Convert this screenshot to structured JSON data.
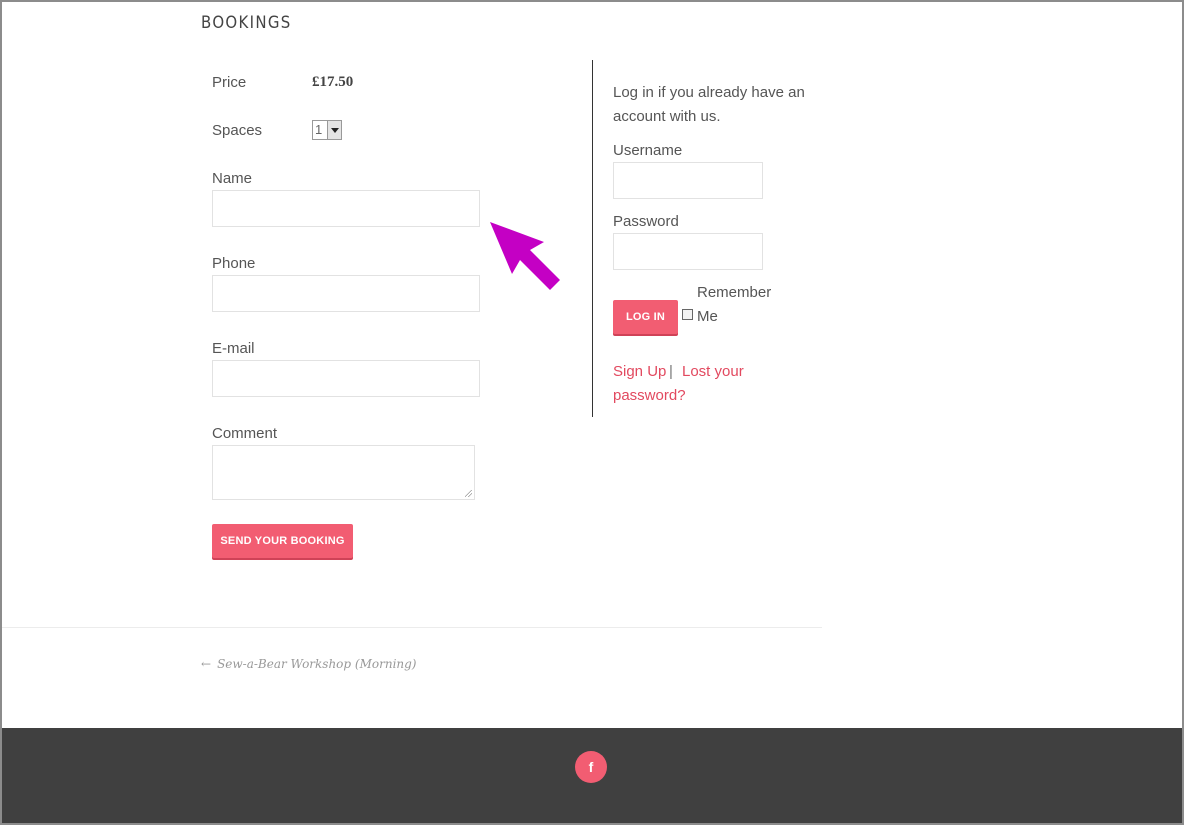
{
  "page": {
    "heading": "BOOKINGS"
  },
  "booking_form": {
    "price_label": "Price",
    "price_value": "£17.50",
    "spaces_label": "Spaces",
    "spaces_value": "1",
    "name_label": "Name",
    "phone_label": "Phone",
    "email_label": "E-mail",
    "comment_label": "Comment",
    "submit_label": "SEND YOUR BOOKING"
  },
  "login": {
    "intro": "Log in if you already have an account with us.",
    "username_label": "Username",
    "password_label": "Password",
    "login_button": "LOG IN",
    "remember_label_1": "Remember",
    "remember_label_2": "Me",
    "signup_link": "Sign Up",
    "separator": "|",
    "lost_password_1": "Lost your",
    "lost_password_2": "password?"
  },
  "post_nav": {
    "arrow": "←",
    "previous": "Sew-a-Bear Workshop (Morning)"
  },
  "footer": {
    "facebook_glyph": "f"
  },
  "colors": {
    "accent": "#f25d72",
    "footer_bg": "#404040",
    "annotation_arrow": "#c400c4"
  },
  "icons": {
    "social": "facebook-icon",
    "annotation": "pointer-arrow-icon"
  }
}
